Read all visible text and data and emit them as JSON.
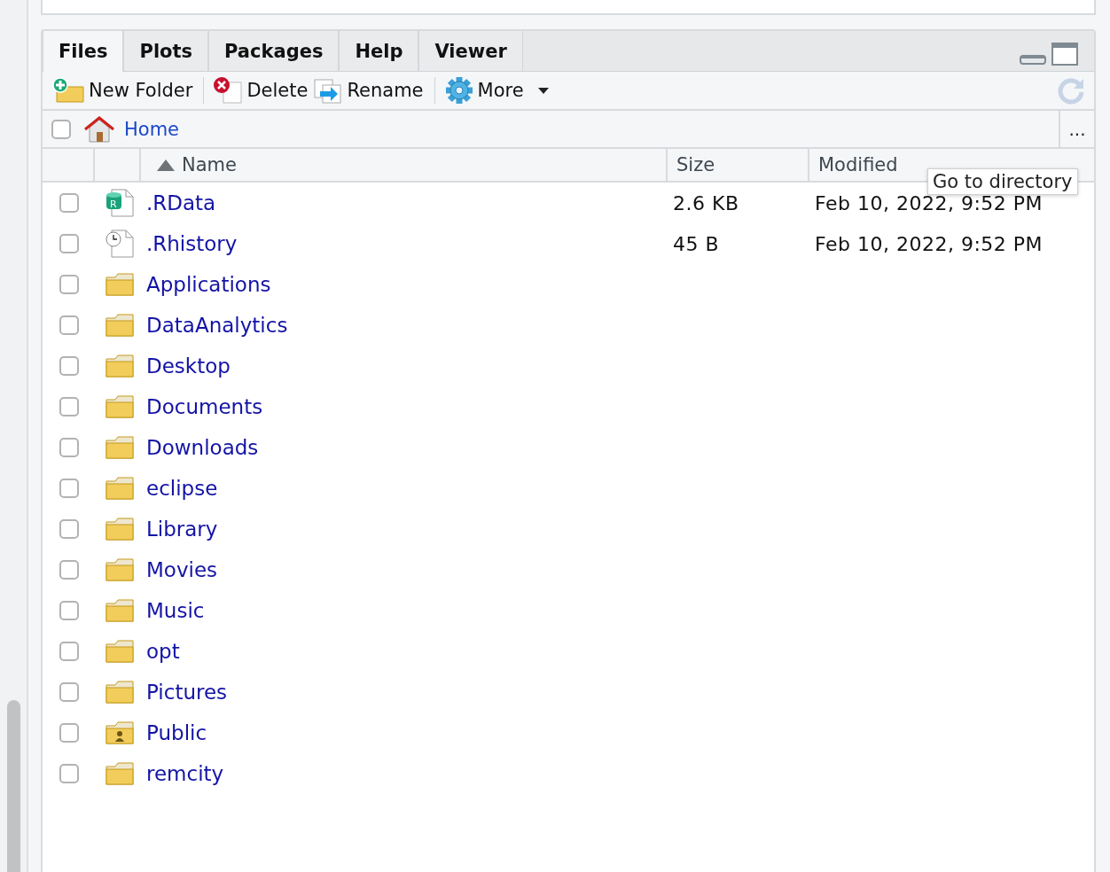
{
  "tabs": [
    {
      "label": "Files",
      "selected": true
    },
    {
      "label": "Plots",
      "selected": false
    },
    {
      "label": "Packages",
      "selected": false
    },
    {
      "label": "Help",
      "selected": false
    },
    {
      "label": "Viewer",
      "selected": false
    }
  ],
  "toolbar": [
    {
      "kind": "new-folder",
      "label": "New Folder"
    },
    {
      "kind": "delete",
      "label": "Delete"
    },
    {
      "kind": "rename",
      "label": "Rename"
    },
    {
      "kind": "more",
      "label": "More"
    }
  ],
  "path": {
    "checked": false,
    "label": "Home",
    "more": "..."
  },
  "columns": {
    "name": "Name",
    "size": "Size",
    "modified": "Modified"
  },
  "rows": [
    {
      "kind": "rdata",
      "icon_label": "R",
      "name": ".RData",
      "size": "2.6 KB",
      "modified": "Feb 10, 2022, 9:52 PM",
      "checked": false
    },
    {
      "kind": "history",
      "name": ".Rhistory",
      "size": "45 B",
      "modified": "Feb 10, 2022, 9:52 PM",
      "checked": false
    },
    {
      "kind": "folder",
      "name": "Applications",
      "checked": false
    },
    {
      "kind": "folder",
      "name": "DataAnalytics",
      "checked": false
    },
    {
      "kind": "folder",
      "name": "Desktop",
      "checked": false
    },
    {
      "kind": "folder",
      "name": "Documents",
      "checked": false
    },
    {
      "kind": "folder",
      "name": "Downloads",
      "checked": false
    },
    {
      "kind": "folder",
      "name": "eclipse",
      "checked": false
    },
    {
      "kind": "folder",
      "name": "Library",
      "checked": false
    },
    {
      "kind": "folder",
      "name": "Movies",
      "checked": false
    },
    {
      "kind": "folder",
      "name": "Music",
      "checked": false
    },
    {
      "kind": "folder",
      "name": "opt",
      "checked": false
    },
    {
      "kind": "folder",
      "name": "Pictures",
      "checked": false
    },
    {
      "kind": "public",
      "name": "Public",
      "checked": false
    },
    {
      "kind": "folder",
      "name": "remcity",
      "checked": false
    }
  ],
  "tooltip": "Go to directory"
}
